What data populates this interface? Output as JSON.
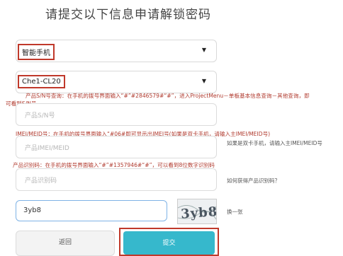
{
  "page": {
    "title": "请提交以下信息申请解锁密码"
  },
  "device_type_select": {
    "value": "智能手机",
    "caret": "▼"
  },
  "model_select": {
    "value": "Che1-CL20",
    "caret": "▼"
  },
  "sn_hint": "产品S/N号查询：在手机的拨号界面输入“#”#2846579#“#”，进入ProjectMenu－单板基本信息查询－其他查询，即",
  "sn_hint_2": "可看到S/N号",
  "sn_input": {
    "placeholder": "产品S/N号"
  },
  "imei_hint": "IMEI/MEID号：在手机的拨号界面输入“#06#即可显示出IMEI号(如果是双卡手机，请输入主IMEI/MEID号)",
  "imei_input": {
    "placeholder": "产品IMEI/MEID"
  },
  "imei_side_note": "如果是双卡手机，请输入主IMEI/MEID号",
  "id_hint": "产品识别码：在手机的拨号界面输入“#”#1357946#“#”，可以看到8位数字识别码",
  "id_input": {
    "placeholder": "产品识别码"
  },
  "id_side_link": "如何获得产品识别码？",
  "captcha": {
    "value": "3yb8",
    "image_text": "3yb8",
    "refresh_label": "换一张"
  },
  "buttons": {
    "back": "返回",
    "submit": "提交"
  }
}
